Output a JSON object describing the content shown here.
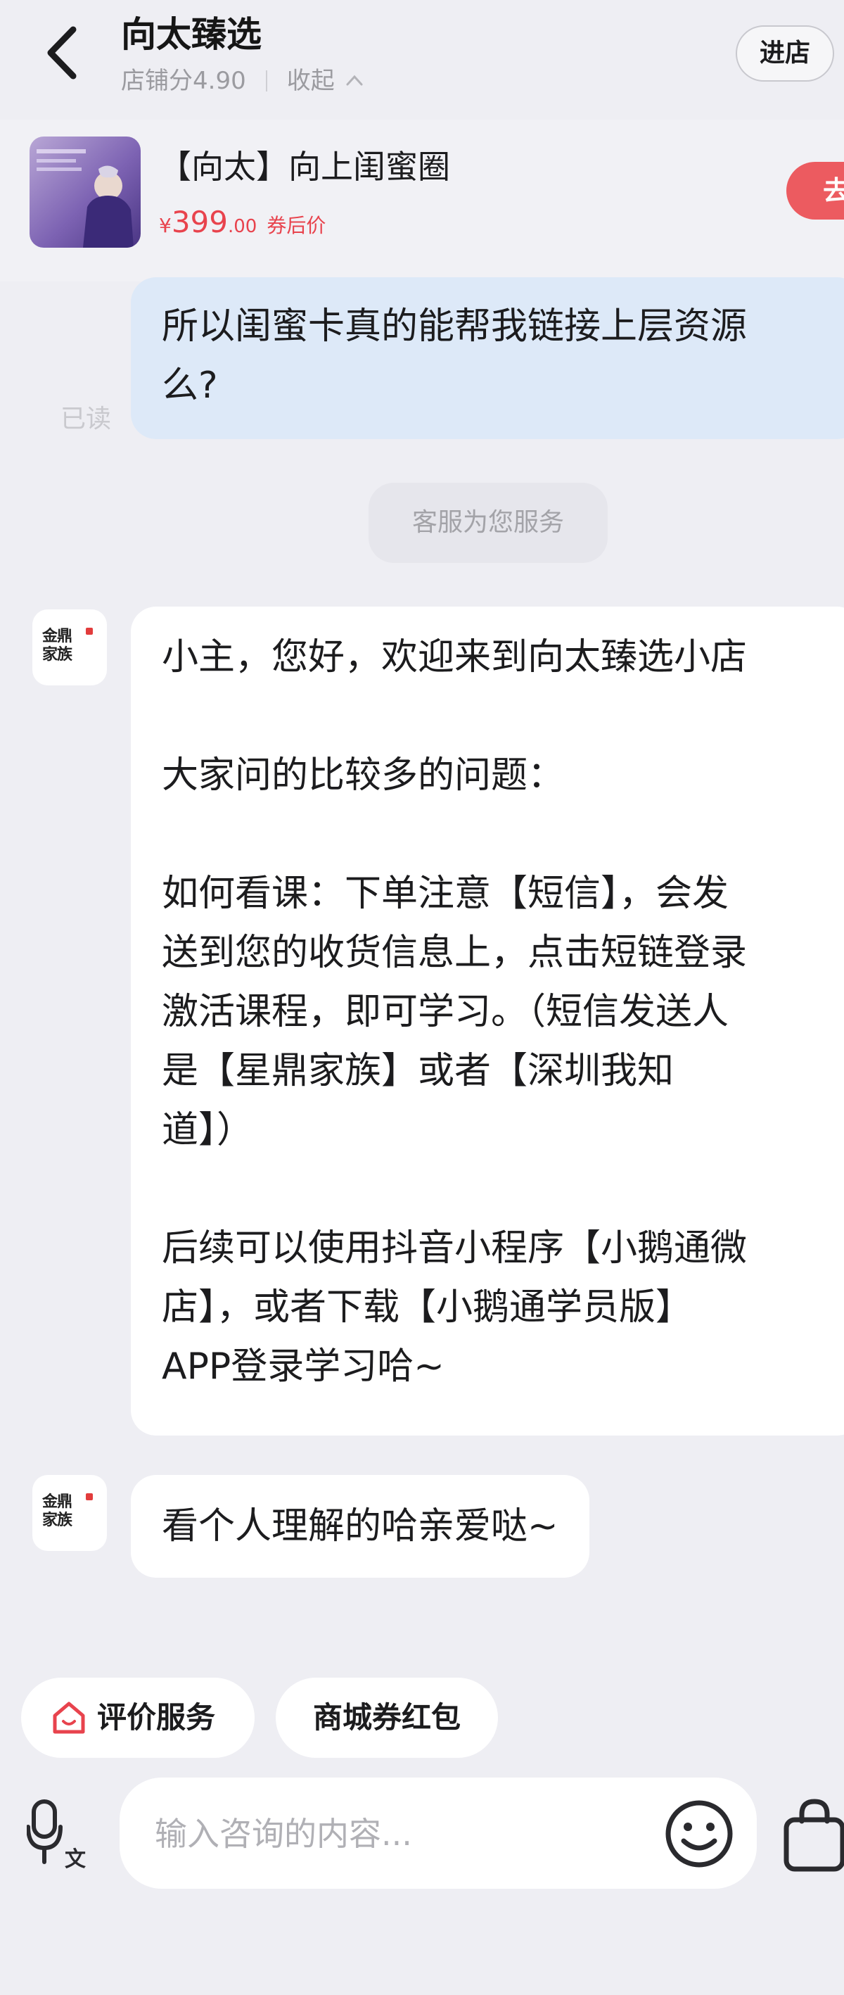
{
  "header": {
    "shop_name": "向太臻选",
    "shop_score": "店铺分4.90",
    "collapse_label": "收起",
    "enter_store_label": "进店"
  },
  "product": {
    "title": "【向太】向上闺蜜圈",
    "price_symbol": "¥",
    "price_int": "399",
    "price_dec": ".00",
    "price_tag": "券后价",
    "buy_label": "去"
  },
  "messages": {
    "user_question": [
      "所以闺蜜卡真的能帮我链接上层资源",
      "么?"
    ],
    "read_status": "已读",
    "system_notice": "客服为您服务",
    "agent_logo_text": [
      "金鼎",
      "家族"
    ],
    "agent_reply_1": {
      "greeting": "小主，您好，欢迎来到向太臻选小店",
      "faq_title": "大家问的比较多的问题：",
      "how_to_lines": [
        "如何看课：下单注意【短信】，会发",
        "送到您的收货信息上，点击短链登录",
        "激活课程，即可学习。（短信发送人",
        "是【星鼎家族】或者【深圳我知",
        "道】）"
      ],
      "followup_lines": [
        "后续可以使用抖音小程序【小鹅通微",
        "店】，或者下载【小鹅通学员版】",
        "APP登录学习哈~"
      ]
    },
    "agent_reply_2": "看个人理解的哈亲爱哒~"
  },
  "quick_actions": {
    "review_label": "评价服务",
    "coupon_label": "商城券红包"
  },
  "input": {
    "placeholder": "输入咨询的内容..."
  },
  "colors": {
    "accent_red": "#e8434d",
    "user_bubble": "#dde9f8",
    "page_bg": "#eeeef3"
  },
  "icons": [
    "back-arrow-icon",
    "chevron-up-icon",
    "home-icon",
    "voice-input-icon",
    "emoji-icon",
    "shopping-bag-icon"
  ]
}
